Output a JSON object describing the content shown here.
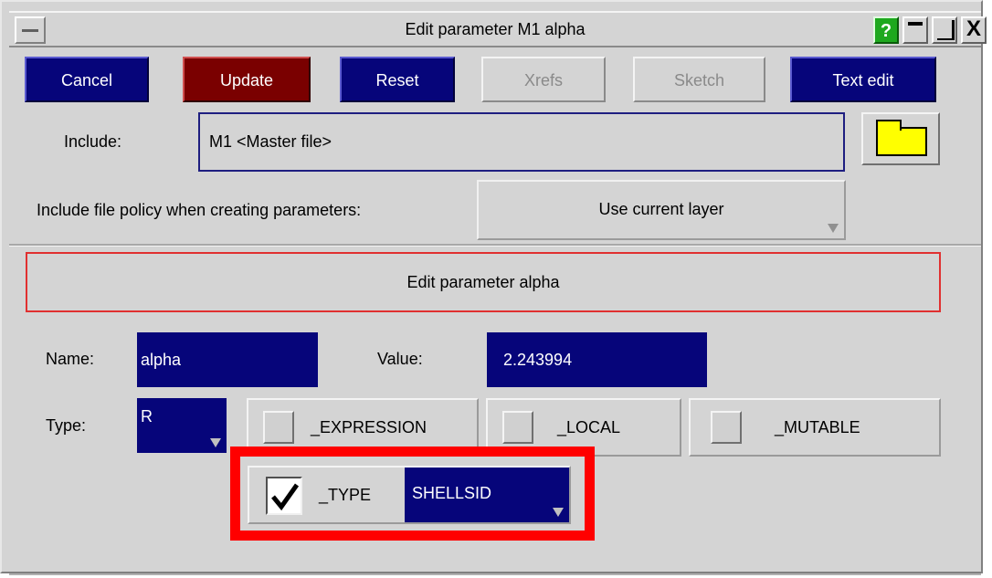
{
  "window": {
    "title": "Edit parameter M1 alpha"
  },
  "titlebar": {
    "help_label": "?",
    "close_label": "X"
  },
  "toolbar": {
    "cancel_label": "Cancel",
    "update_label": "Update",
    "reset_label": "Reset",
    "xrefs_label": "Xrefs",
    "sketch_label": "Sketch",
    "text_edit_label": "Text edit"
  },
  "include": {
    "label": "Include:",
    "value": "M1  <Master file>"
  },
  "policy": {
    "label": "Include file policy when creating parameters:",
    "selected": "Use current layer"
  },
  "section": {
    "title": "Edit parameter alpha"
  },
  "param": {
    "name_label": "Name:",
    "name_value": "alpha",
    "value_label": "Value:",
    "value_value": "2.243994",
    "type_label": "Type:",
    "type_value": "R"
  },
  "options": {
    "expression_label": "_EXPRESSION",
    "local_label": "_LOCAL",
    "mutable_label": "_MUTABLE",
    "type_label": "_TYPE",
    "type_checked": true,
    "type_value": "SHELLSID"
  },
  "colors": {
    "button_blue": "#06057a",
    "button_red": "#7a0000",
    "highlight": "#ff0000",
    "section_border": "#e03030"
  }
}
